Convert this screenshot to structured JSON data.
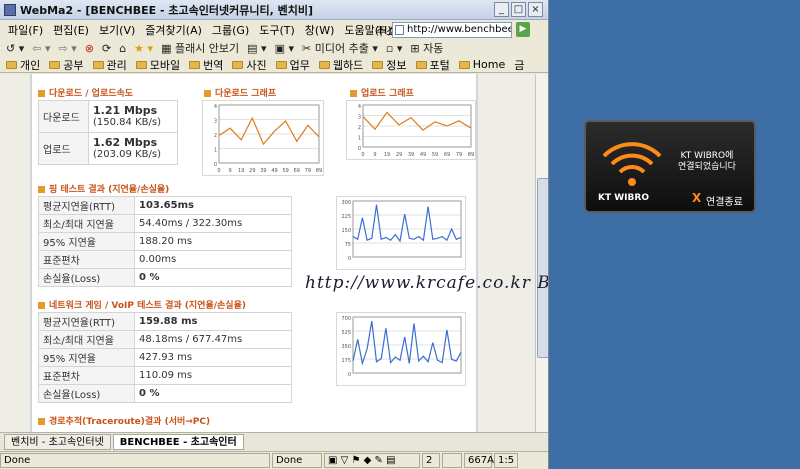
{
  "window": {
    "title": "WebMa2 - [BENCHBEE - 초고속인터넷커뮤니티, 벤치비]"
  },
  "menu": [
    "파일(F)",
    "편집(E)",
    "보기(V)",
    "즐겨찾기(A)",
    "그룹(G)",
    "도구(T)",
    "창(W)",
    "도움말(H)"
  ],
  "address": {
    "label": "주소",
    "value": "http://www.benchbee.co.kr"
  },
  "toolbar": {
    "flash_block": "플래시 안보기",
    "media_extract": "미디어 추출",
    "more": "자동"
  },
  "favorites": [
    "개인",
    "공부",
    "관리",
    "모바일",
    "번역",
    "사진",
    "업무",
    "웹하드",
    "정보",
    "포털",
    "Home",
    "금"
  ],
  "download_speed": {
    "title": "다운로드 / 업로드속도",
    "rows": [
      {
        "label": "다운로드",
        "mbps": "1.21 Mbps",
        "kbs": "(150.84 KB/s)"
      },
      {
        "label": "업로드",
        "mbps": "1.62 Mbps",
        "kbs": "(203.09 KB/s)"
      }
    ]
  },
  "graphs": {
    "download_title": "다운로드 그래프",
    "upload_title": "업로드 그래프"
  },
  "ping": {
    "title": "핑 테스트 결과 (지연율/손실율)",
    "rows": [
      {
        "label": "평균지연율(RTT)",
        "value": "103.65ms"
      },
      {
        "label": "최소/최대 지연율",
        "value": "54.40ms / 322.30ms"
      },
      {
        "label": "95% 지연율",
        "value": "188.20 ms"
      },
      {
        "label": "표준편차",
        "value": "0.00ms"
      },
      {
        "label": "손실율(Loss)",
        "value": "0 %"
      }
    ]
  },
  "game": {
    "title": "네트워크 게임 / VoIP 테스트 결과 (지연율/손실율)",
    "rows": [
      {
        "label": "평균지연율(RTT)",
        "value": "159.88 ms"
      },
      {
        "label": "최소/최대 지연율",
        "value": "48.18ms / 677.47ms"
      },
      {
        "label": "95% 지연율",
        "value": "427.93 ms"
      },
      {
        "label": "표준편차",
        "value": "110.09 ms"
      },
      {
        "label": "손실율(Loss)",
        "value": "0 %"
      }
    ]
  },
  "traceroute": {
    "title": "경로추적(Traceroute)결과 (서버→PC)"
  },
  "watermark": "http://www.krcafe.co.kr   Busari",
  "tabs": [
    "벤치비 - 초고속인터넷",
    "BENCHBEE - 초고속인터"
  ],
  "status": {
    "left": "Done",
    "mid": "Done",
    "count": "2",
    "code": "667A",
    "ratio": "1:5"
  },
  "wibro": {
    "logo": "KT WIBRO",
    "message_line1": "KT WIBRO에",
    "message_line2": "연결되었습니다",
    "disconnect": "연결종료",
    "x": "X"
  },
  "colors": {
    "desktop": "#3d6ea5",
    "accent": "#c8541a",
    "graph_orange": "#e07b17",
    "graph_blue": "#3a6fd0"
  },
  "chart_data": [
    {
      "type": "line",
      "title": "다운로드 그래프",
      "x": [
        0,
        9,
        19,
        29,
        39,
        49,
        59,
        69,
        79,
        89
      ],
      "ylim": [
        0,
        4
      ],
      "series": [
        {
          "values": [
            1.9,
            2.4,
            1.6,
            3.1,
            1.3,
            2.2,
            2.9,
            1.5,
            2.6,
            1.8
          ]
        }
      ],
      "grid": true
    },
    {
      "type": "line",
      "title": "업로드 그래프",
      "x": [
        0,
        9,
        19,
        29,
        39,
        49,
        59,
        69,
        79,
        89
      ],
      "ylim": [
        0,
        4
      ],
      "series": [
        {
          "values": [
            2.9,
            1.7,
            3.3,
            2.1,
            2.8,
            1.6,
            2.4,
            2.0,
            2.5,
            1.8
          ]
        }
      ],
      "grid": true
    },
    {
      "type": "line",
      "ylim": [
        0,
        300
      ],
      "series": [
        {
          "values": [
            110,
            95,
            210,
            90,
            100,
            280,
            95,
            105,
            90,
            120,
            85,
            230,
            100,
            95,
            110,
            90,
            270,
            95,
            100,
            110,
            90,
            150,
            95,
            105
          ]
        }
      ],
      "grid": true
    },
    {
      "type": "line",
      "ylim": [
        0,
        700
      ],
      "series": [
        {
          "values": [
            150,
            420,
            120,
            300,
            650,
            140,
            180,
            560,
            130,
            200,
            160,
            450,
            120,
            620,
            150,
            210,
            140,
            380,
            160,
            130,
            540,
            170,
            150,
            260
          ]
        }
      ],
      "grid": true
    }
  ]
}
